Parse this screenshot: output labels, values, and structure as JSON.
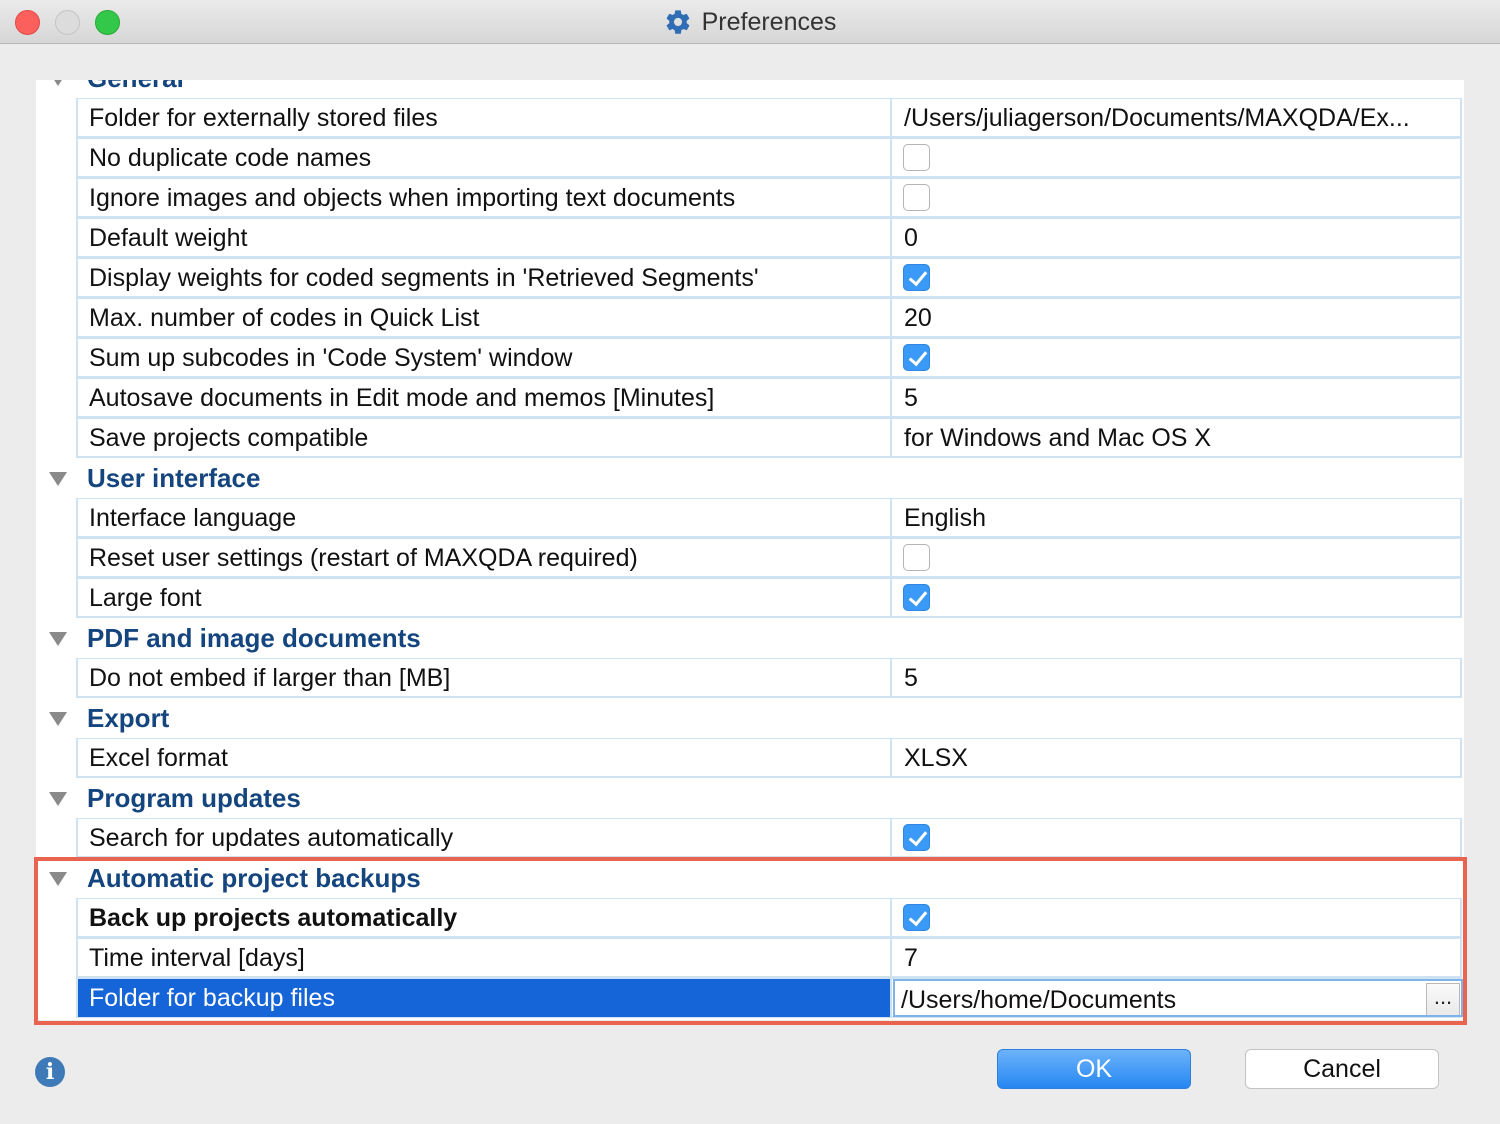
{
  "window": {
    "title": "Preferences",
    "icon": "gear-icon"
  },
  "groups": {
    "general": "General",
    "user_interface": "User interface",
    "pdf_images": "PDF and image documents",
    "export": "Export",
    "program_updates": "Program updates",
    "auto_backups": "Automatic project backups"
  },
  "settings": {
    "external_folder": {
      "label": "Folder for externally stored files",
      "value": "/Users/juliagerson/Documents/MAXQDA/Ex..."
    },
    "no_dup_codes": {
      "label": "No duplicate code names",
      "checked": false
    },
    "ignore_images": {
      "label": "Ignore images and objects when importing text documents",
      "checked": false
    },
    "default_weight": {
      "label": "Default weight",
      "value": "0"
    },
    "display_weights": {
      "label": "Display weights for coded segments in 'Retrieved Segments'",
      "checked": true
    },
    "max_codes": {
      "label": "Max. number of codes in Quick List",
      "value": "20"
    },
    "sum_subcodes": {
      "label": "Sum up subcodes in 'Code System' window",
      "checked": true
    },
    "autosave": {
      "label": "Autosave documents in Edit mode and memos [Minutes]",
      "value": "5"
    },
    "save_compatible": {
      "label": "Save projects compatible",
      "value": "for Windows and Mac OS X"
    },
    "interface_language": {
      "label": "Interface language",
      "value": "English"
    },
    "reset_settings": {
      "label": "Reset user settings (restart of MAXQDA required)",
      "checked": false
    },
    "large_font": {
      "label": "Large font",
      "checked": true
    },
    "embed_limit": {
      "label": "Do not embed if larger than [MB]",
      "value": "5"
    },
    "excel_format": {
      "label": "Excel format",
      "value": "XLSX"
    },
    "search_updates": {
      "label": "Search for updates automatically",
      "checked": true
    },
    "backup_auto": {
      "label": "Back up projects automatically",
      "checked": true
    },
    "time_interval": {
      "label": "Time interval [days]",
      "value": "7"
    },
    "backup_folder": {
      "label": "Folder for backup files",
      "value": "/Users/home/Documents",
      "browse_label": "..."
    }
  },
  "footer": {
    "info_glyph": "i",
    "ok_label": "OK",
    "cancel_label": "Cancel"
  },
  "colors": {
    "accent": "#1565d8",
    "group_heading": "#15457e",
    "checkbox_on": "#3b9af7",
    "highlight_frame": "#e8644f"
  }
}
